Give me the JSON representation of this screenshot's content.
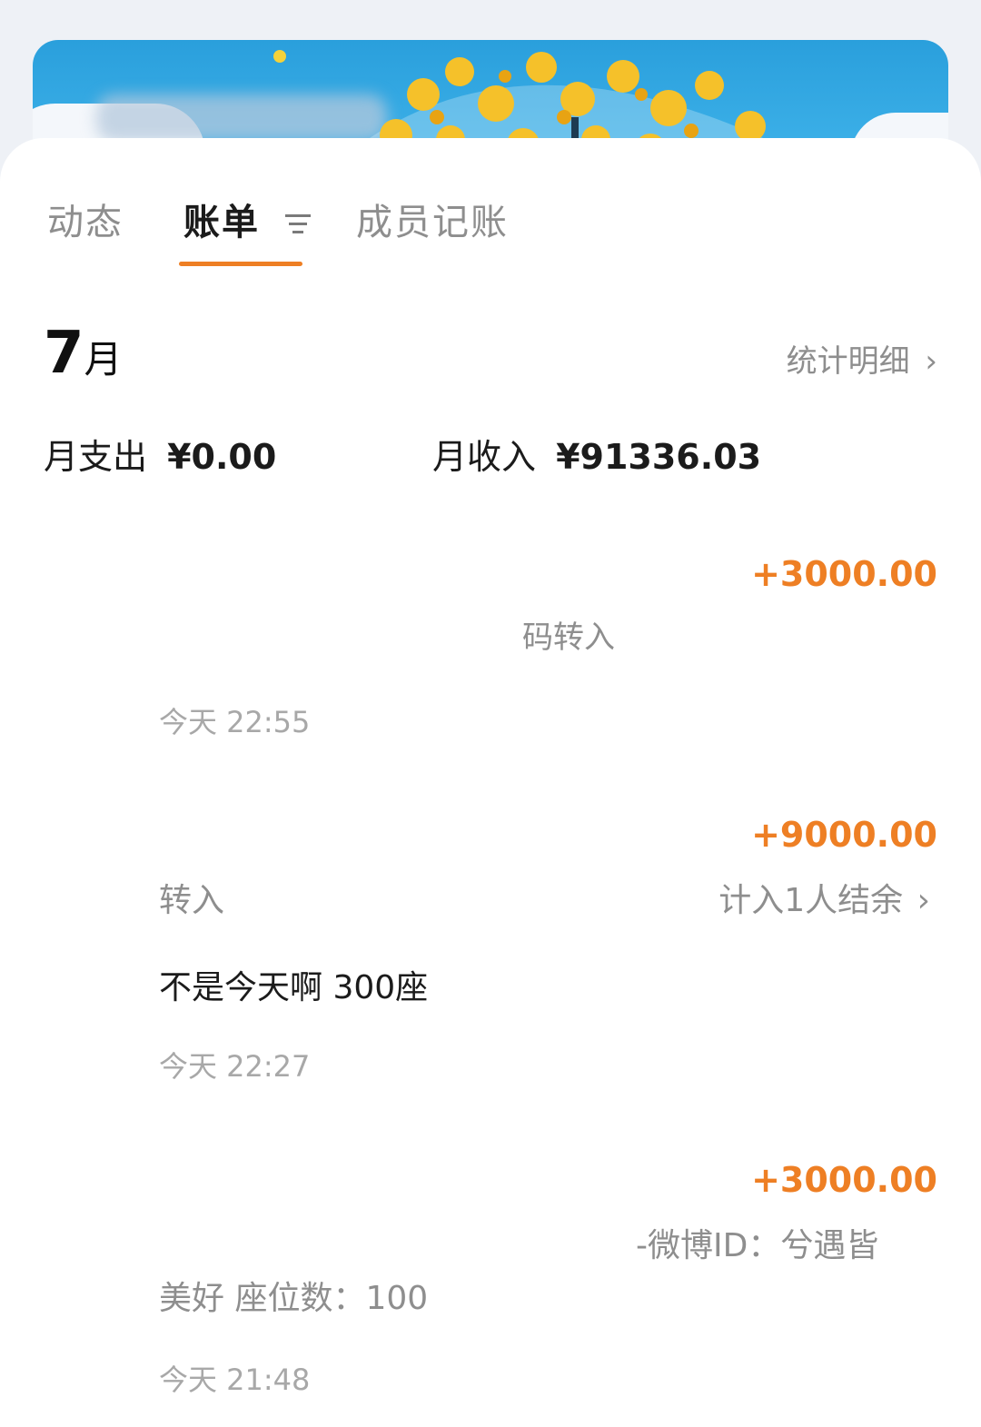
{
  "tabs": {
    "dynamics": "动态",
    "bills": "账单",
    "member_accounting": "成员记账"
  },
  "header": {
    "month_number": "7",
    "month_unit": "月",
    "stats_link": "统计明细"
  },
  "summary": {
    "expense_label": "月支出",
    "expense_value": "¥0.00",
    "income_label": "月收入",
    "income_value": "¥91336.03"
  },
  "transactions": [
    {
      "amount": "+3000.00",
      "desc": "码转入",
      "time": "今天 22:55"
    },
    {
      "amount": "+9000.00",
      "type": "转入",
      "settle_link": "计入1人结余",
      "note": "不是今天啊 300座",
      "time": "今天 22:27"
    },
    {
      "amount": "+3000.00",
      "note_line1": "-微博ID：兮遇皆",
      "note_line2": "美好 座位数：100",
      "time": "今天 21:48"
    }
  ],
  "colors": {
    "accent": "#ee7f24",
    "sky": "#3fb3ea",
    "flowers": "#f5c12a"
  }
}
